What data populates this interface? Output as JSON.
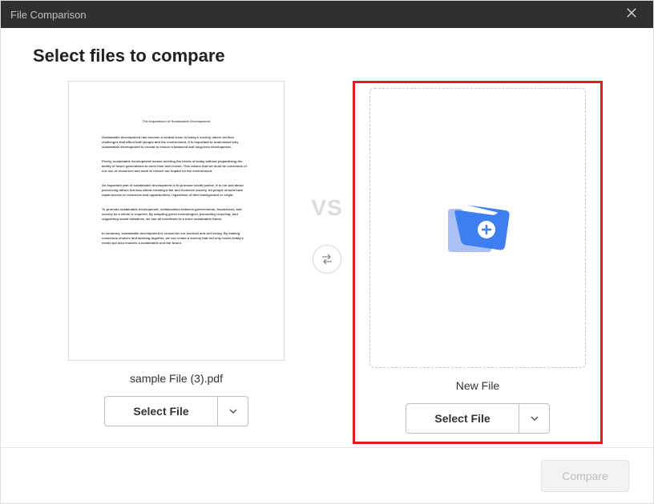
{
  "titlebar": {
    "title": "File Comparison"
  },
  "heading": "Select files to compare",
  "vs_label": "VS",
  "left": {
    "filename": "sample File (3).pdf",
    "select_label": "Select File",
    "doc_title": "The Importance of Sustainable Development",
    "para1": "Sustainable development has become a central issue in today's society, where we face challenges that affect both people and the environment. It is important to understand why sustainable development is crucial to ensure a balanced and long-term development.",
    "para2": "Firstly, sustainable development means meeting the needs of today without jeopardizing the ability of future generations to meet their own needs. This means that we must be conscious of our use of resources and work to reduce our impact on the environment.",
    "para3": "An important part of sustainable development is to promote social justice. It is not just about preserving nature but also about creating a fair and inclusive society. All people should have equal access to resources and opportunities, regardless of their background or origin.",
    "para4": "To promote sustainable development, collaboration between governments, businesses, and society as a whole is required. By adopting green technologies, promoting recycling, and supporting social initiatives, we can all contribute to a more sustainable future.",
    "para5": "In summary, sustainable development is crucial for our survival and well-being. By making conscious choices and working together, we can create a society that not only meets today's needs but also ensures a sustainable and fair future."
  },
  "right": {
    "filename": "New File",
    "select_label": "Select File"
  },
  "footer": {
    "compare_label": "Compare"
  }
}
